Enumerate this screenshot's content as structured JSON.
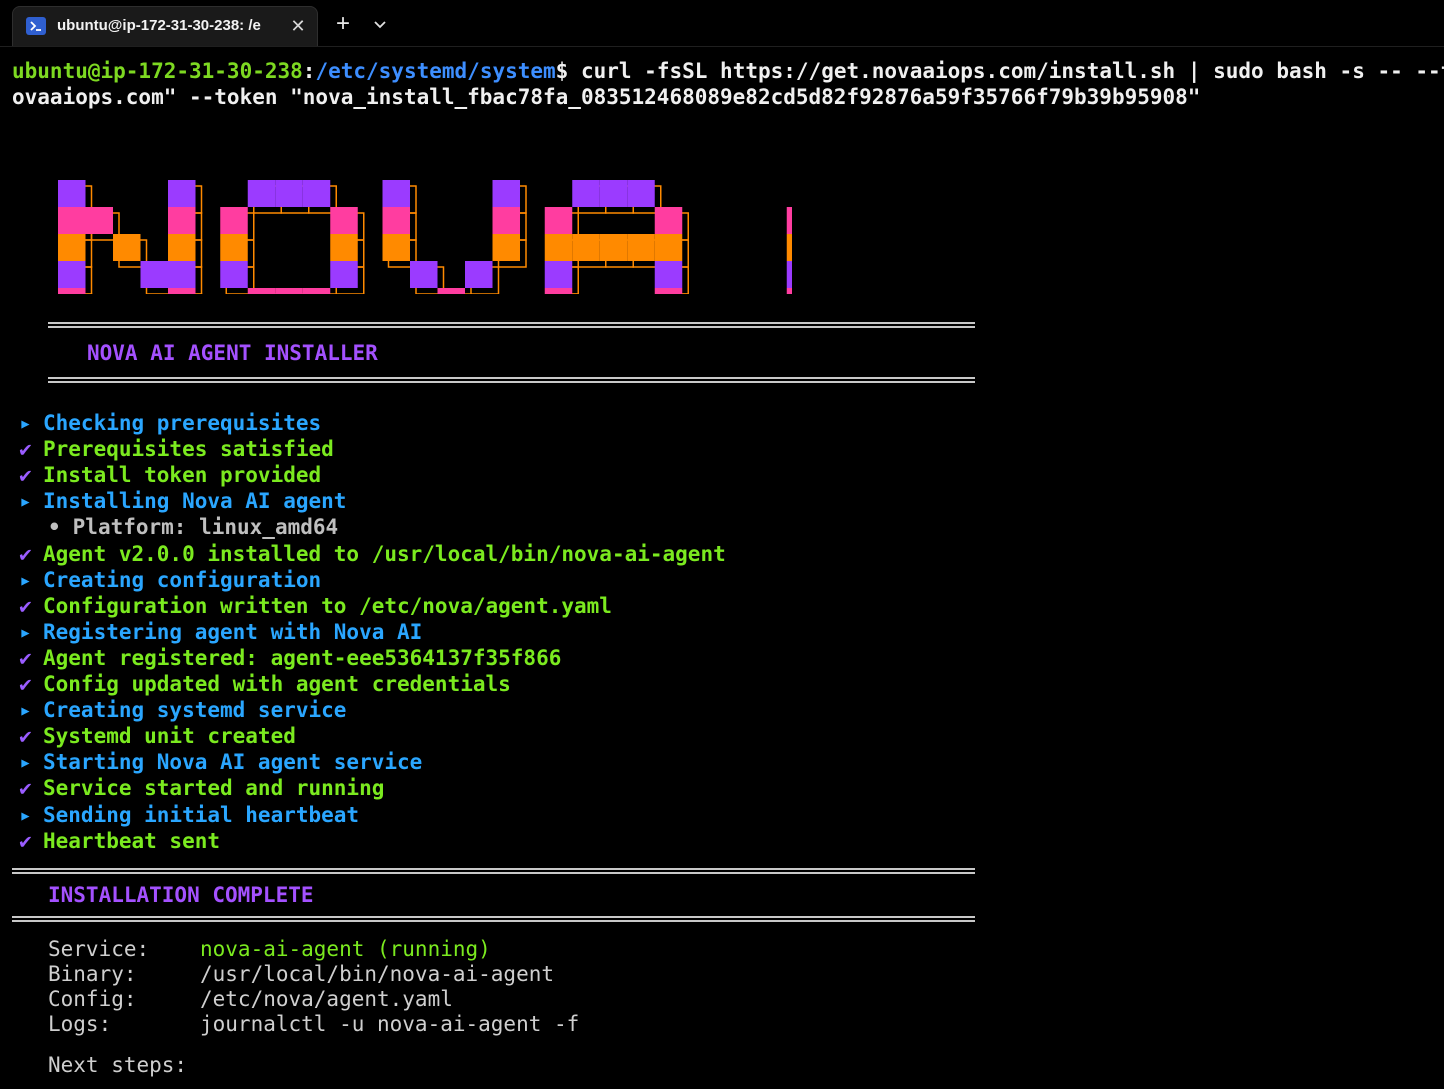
{
  "tab": {
    "title": "ubuntu@ip-172-31-30-238: /e",
    "icon": "terminal-icon",
    "close_glyph": "✕",
    "new_tab_glyph": "+"
  },
  "prompt": {
    "user_host": "ubuntu@ip-172-31-30-238",
    "separator": ":",
    "path": "/etc/systemd/system",
    "symbol": "$",
    "command": " curl -fsSL https://get.novaaiops.com/install.sh | sudo bash -s -- --token \"no",
    "command_wrap": "ovaaiops.com\" --token \"nova_install_fbac78fa_083512468089e82cd5d82f92876a59f35766f79b39b95908\""
  },
  "banner": {
    "text": "NOVA AI",
    "colors": [
      "#9b3bff",
      "#ff3da0",
      "#ff8a00",
      "#9b3bff",
      "#ff3da0"
    ]
  },
  "installer_title": "NOVA AI AGENT INSTALLER",
  "markers": {
    "info": "▸",
    "ok": "✔",
    "sub": "•"
  },
  "steps": [
    {
      "kind": "info",
      "text": "Checking prerequisites"
    },
    {
      "kind": "ok",
      "text": "Prerequisites satisfied"
    },
    {
      "kind": "ok",
      "text": "Install token provided"
    },
    {
      "kind": "info",
      "text": "Installing Nova AI agent"
    },
    {
      "kind": "sub",
      "text": "Platform: linux_amd64"
    },
    {
      "kind": "ok",
      "text": "Agent v2.0.0 installed to /usr/local/bin/nova-ai-agent"
    },
    {
      "kind": "info",
      "text": "Creating configuration"
    },
    {
      "kind": "ok",
      "text": "Configuration written to /etc/nova/agent.yaml"
    },
    {
      "kind": "info",
      "text": "Registering agent with Nova AI"
    },
    {
      "kind": "ok",
      "text": "Agent registered: agent-eee5364137f35f866"
    },
    {
      "kind": "ok",
      "text": "Config updated with agent credentials"
    },
    {
      "kind": "info",
      "text": "Creating systemd service"
    },
    {
      "kind": "ok",
      "text": "Systemd unit created"
    },
    {
      "kind": "info",
      "text": "Starting Nova AI agent service"
    },
    {
      "kind": "ok",
      "text": "Service started and running"
    },
    {
      "kind": "info",
      "text": "Sending initial heartbeat"
    },
    {
      "kind": "ok",
      "text": "Heartbeat sent"
    }
  ],
  "complete_title": "INSTALLATION COMPLETE",
  "summary": [
    {
      "label": "Service:",
      "value": "nova-ai-agent (running)",
      "status": "running"
    },
    {
      "label": "Binary:",
      "value": "/usr/local/bin/nova-ai-agent",
      "status": ""
    },
    {
      "label": "Config:",
      "value": "/etc/nova/agent.yaml",
      "status": ""
    },
    {
      "label": "Logs:",
      "value": "journalctl -u nova-ai-agent -f",
      "status": ""
    }
  ],
  "next_steps_label": "Next steps:",
  "colors": {
    "user": "#7dd921",
    "path": "#3d8eff",
    "info": "#2aa6ff",
    "ok": "#7bea1f",
    "heading": "#a451ff"
  }
}
